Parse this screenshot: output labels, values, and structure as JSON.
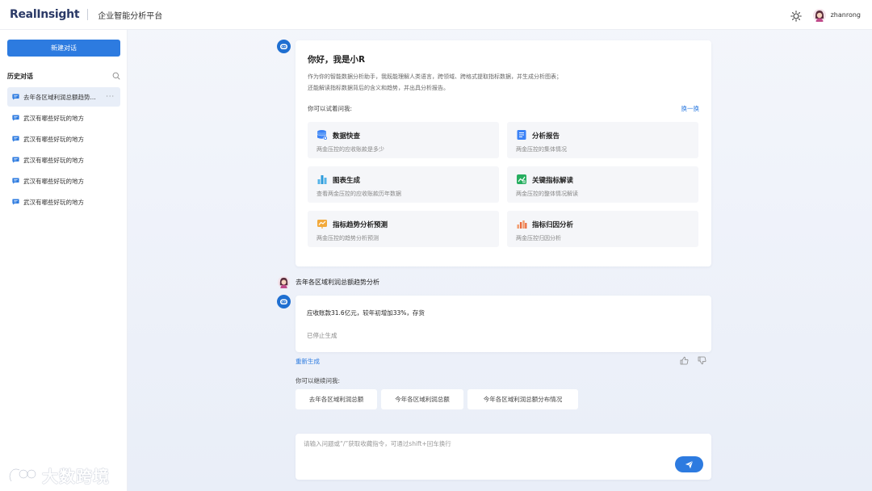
{
  "header": {
    "logo_text": "RealInsight",
    "app_title": "企业智能分析平台",
    "username": "zhanrong"
  },
  "sidebar": {
    "new_chat_label": "新建对话",
    "history_title": "历史对话",
    "items": [
      {
        "label": "去年各区域利润总额趋势..."
      },
      {
        "label": "武汉有哪些好玩的地方"
      },
      {
        "label": "武汉有哪些好玩的地方"
      },
      {
        "label": "武汉有哪些好玩的地方"
      },
      {
        "label": "武汉有哪些好玩的地方"
      },
      {
        "label": "武汉有哪些好玩的地方"
      }
    ],
    "more_label": "···"
  },
  "welcome": {
    "greeting": "你好，我是小R",
    "intro_line1": "作为你的智能数据分析助手，我既能理解人类语言，跨领域、跨格式提取指标数据，并生成分析图表；",
    "intro_line2": "还能解读指标数据背后的含义和趋势，并出具分析报告。",
    "try_label": "你可以试着问我:",
    "refresh_label": "换一换",
    "tiles": [
      {
        "title": "数据快查",
        "subtitle": "两金压控的应收账款是多少",
        "icon": "database-icon",
        "color": "#3b82f6"
      },
      {
        "title": "分析报告",
        "subtitle": "两金压控的集体情况",
        "icon": "report-icon",
        "color": "#3b82f6"
      },
      {
        "title": "图表生成",
        "subtitle": "查看两金压控的应收账款历年数据",
        "icon": "bar-chart-icon",
        "color": "#2d9cdb"
      },
      {
        "title": "关键指标解读",
        "subtitle": "两金压控的整体情况解读",
        "icon": "analysis-icon",
        "color": "#27ae60"
      },
      {
        "title": "指标趋势分析预测",
        "subtitle": "两金压控的趋势分析预测",
        "icon": "trend-icon",
        "color": "#f2a93b"
      },
      {
        "title": "指标归因分析",
        "subtitle": "两金压控归因分析",
        "icon": "attribution-icon",
        "color": "#eb6a3c"
      }
    ]
  },
  "conversation": {
    "user_question": "去年各区域利润总额趋势分析",
    "answer_text": "应收账款31.6亿元，较年初增加33%，存货",
    "answer_status": "已停止生成",
    "regenerate_label": "重新生成",
    "continue_label": "你可以继续问我:",
    "suggestions": [
      {
        "label": "去年各区域利润总额"
      },
      {
        "label": "今年各区域利润总额"
      },
      {
        "label": "今年各区域利润总额分布情况"
      }
    ]
  },
  "input": {
    "placeholder": "请输入问题或“/”获取收藏指令，可通过shift+回车换行",
    "value": ""
  },
  "watermark": {
    "text": "大数跨境"
  },
  "colors": {
    "accent": "#2d7be0"
  }
}
